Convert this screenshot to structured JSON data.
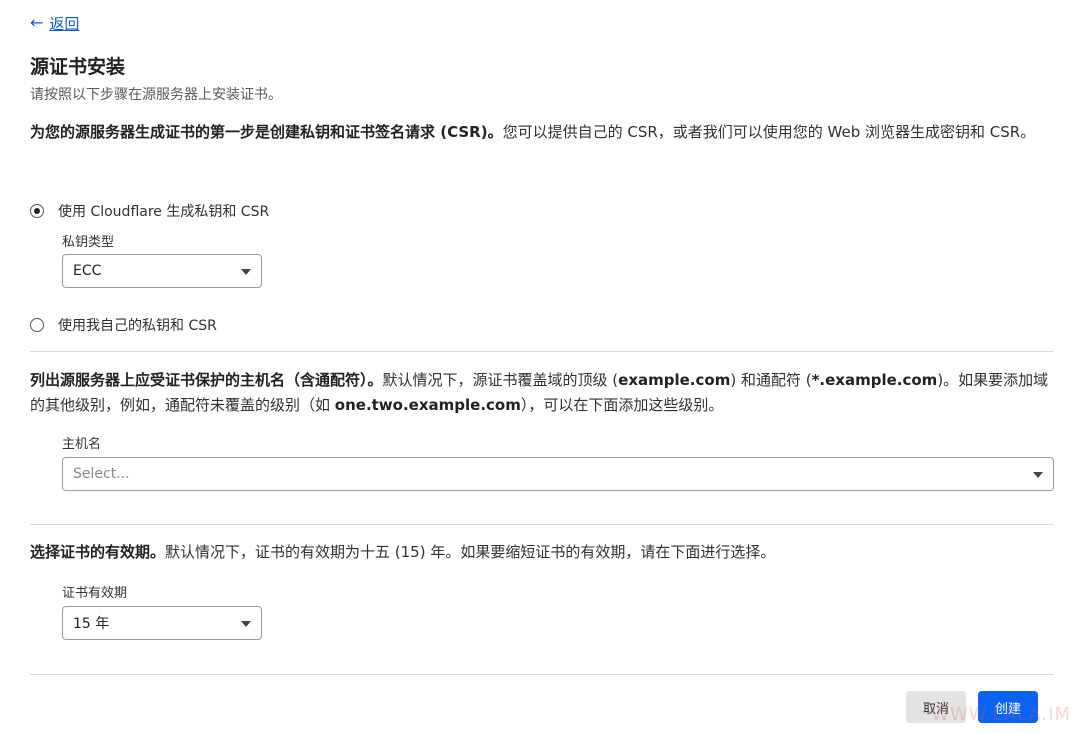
{
  "back": {
    "arrow": "←",
    "label": "返回"
  },
  "header": {
    "title": "源证书安装",
    "subtitle": "请按照以下步骤在源服务器上安装证书。"
  },
  "csr_section": {
    "intro_bold": "为您的源服务器生成证书的第一步是创建私钥和证书签名请求 (CSR)。",
    "intro_rest": "您可以提供自己的 CSR，或者我们可以使用您的 Web 浏览器生成密钥和 CSR。",
    "option_cloudflare": "使用 Cloudflare 生成私钥和 CSR",
    "key_type_label": "私钥类型",
    "key_type_value": "ECC",
    "option_own": "使用我自己的私钥和 CSR"
  },
  "hostname_section": {
    "p1_bold": "列出源服务器上应受证书保护的主机名（含通配符）。",
    "p1_text": "默认情况下，源证书覆盖域的顶级 (",
    "p1_domain": "example.com",
    "p1_text2": ") 和通配符 (",
    "p1_wildcard": "*.example.com",
    "p1_text3": ")。如果要添加域的其他级别，例如，通配符未覆盖的级别（如 ",
    "p1_example": "one.two.example.com",
    "p1_text4": "），可以在下面添加这些级别。",
    "hostname_label": "主机名",
    "hostname_placeholder": "Select..."
  },
  "validity_section": {
    "bold": "选择证书的有效期。",
    "text": "默认情况下，证书的有效期为十五 (15) 年。如果要缩短证书的有效期，请在下面进行选择。",
    "label": "证书有效期",
    "value": "15 年"
  },
  "actions": {
    "cancel": "取消",
    "create": "创建"
  },
  "watermark": "WWW.LALA.IM"
}
